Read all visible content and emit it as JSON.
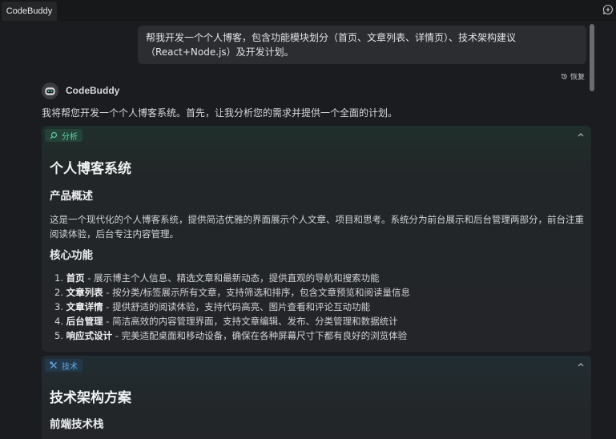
{
  "window": {
    "tab_title": "CodeBuddy"
  },
  "icons": {
    "new_chat": "chat-plus-icon",
    "restore": "history-icon",
    "avatar": "codebuddy-avatar-icon",
    "analysis": "search-icon",
    "tech": "tools-icon",
    "collapse": "chevron-up-icon"
  },
  "user_message": {
    "text": "帮我开发一个个人博客，包含功能模块划分（首页、文章列表、详情页）、技术架构建议（React+Node.js）及开发计划。"
  },
  "restore": {
    "label": "恢复"
  },
  "assistant": {
    "name": "CodeBuddy",
    "intro": "我将帮您开发一个个人博客系统。首先，让我分析您的需求并提供一个全面的计划。"
  },
  "analysis_block": {
    "label": "分析",
    "title": "个人博客系统",
    "overview_heading": "产品概述",
    "overview_text": "这是一个现代化的个人博客系统，提供简洁优雅的界面展示个人文章、项目和思考。系统分为前台展示和后台管理两部分，前台注重阅读体验，后台专注内容管理。",
    "features_heading": "核心功能",
    "features": [
      {
        "num": "1. ",
        "name": "首页",
        "desc": " - 展示博主个人信息、精选文章和最新动态，提供直观的导航和搜索功能"
      },
      {
        "num": "2. ",
        "name": "文章列表",
        "desc": " - 按分类/标签展示所有文章，支持筛选和排序，包含文章预览和阅读量信息"
      },
      {
        "num": "3. ",
        "name": "文章详情",
        "desc": " - 提供舒适的阅读体验，支持代码高亮、图片查看和评论互动功能"
      },
      {
        "num": "4. ",
        "name": "后台管理",
        "desc": " - 简洁高效的内容管理界面，支持文章编辑、发布、分类管理和数据统计"
      },
      {
        "num": "5. ",
        "name": "响应式设计",
        "desc": " - 完美适配桌面和移动设备，确保在各种屏幕尺寸下都有良好的浏览体验"
      }
    ]
  },
  "tech_block": {
    "label": "技术",
    "title": "技术架构方案",
    "frontend_heading": "前端技术栈"
  },
  "colors": {
    "analysis_accent": "#5fd0a6",
    "tech_accent": "#62a9e8",
    "background": "#1b1c1f"
  }
}
